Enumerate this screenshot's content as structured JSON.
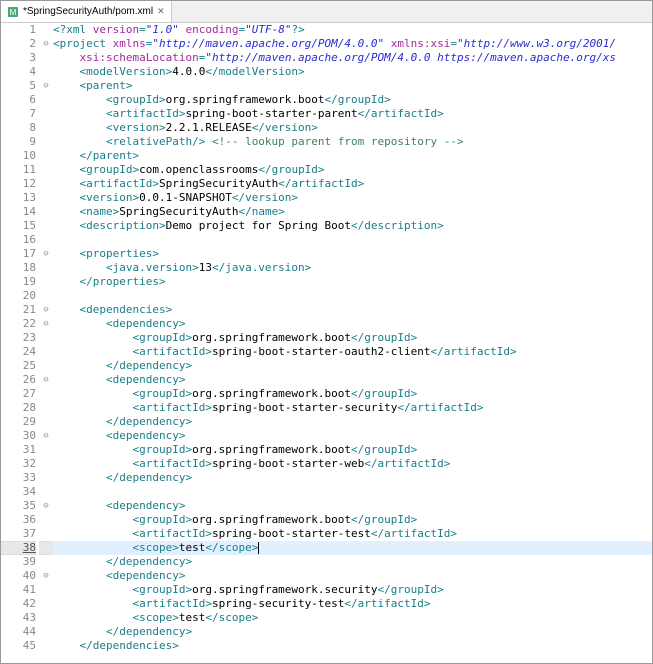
{
  "tab": {
    "icon": "M",
    "label": "*SpringSecurityAuth/pom.xml",
    "closeGlyph": "✕"
  },
  "currentLine": 38,
  "lines": [
    {
      "n": 1,
      "fold": "",
      "indent": 0,
      "tokens": [
        [
          "pi",
          "<?xml "
        ],
        [
          "attr",
          "version"
        ],
        [
          "pi",
          "="
        ],
        [
          "str",
          "\"1.0\""
        ],
        [
          "pi",
          " "
        ],
        [
          "attr",
          "encoding"
        ],
        [
          "pi",
          "="
        ],
        [
          "str",
          "\"UTF-8\""
        ],
        [
          "pi",
          "?>"
        ]
      ]
    },
    {
      "n": 2,
      "fold": "⊖",
      "indent": 0,
      "tokens": [
        [
          "tag",
          "<project "
        ],
        [
          "attr",
          "xmlns"
        ],
        [
          "tag",
          "="
        ],
        [
          "str",
          "\"http://maven.apache.org/POM/4.0.0\""
        ],
        [
          "tag",
          " "
        ],
        [
          "attr",
          "xmlns:xsi"
        ],
        [
          "tag",
          "="
        ],
        [
          "str",
          "\"http://www.w3.org/2001/"
        ]
      ]
    },
    {
      "n": 3,
      "fold": "",
      "indent": 1,
      "tokens": [
        [
          "attr",
          "xsi:schemaLocation"
        ],
        [
          "tag",
          "="
        ],
        [
          "str",
          "\"http://maven.apache.org/POM/4.0.0 https://maven.apache.org/xs"
        ]
      ]
    },
    {
      "n": 4,
      "fold": "",
      "indent": 1,
      "tokens": [
        [
          "tag",
          "<modelVersion>"
        ],
        [
          "txt",
          "4.0.0"
        ],
        [
          "tag",
          "</modelVersion>"
        ]
      ]
    },
    {
      "n": 5,
      "fold": "⊖",
      "indent": 1,
      "tokens": [
        [
          "tag",
          "<parent>"
        ]
      ]
    },
    {
      "n": 6,
      "fold": "",
      "indent": 2,
      "tokens": [
        [
          "tag",
          "<groupId>"
        ],
        [
          "txt",
          "org.springframework.boot"
        ],
        [
          "tag",
          "</groupId>"
        ]
      ]
    },
    {
      "n": 7,
      "fold": "",
      "indent": 2,
      "tokens": [
        [
          "tag",
          "<artifactId>"
        ],
        [
          "txt",
          "spring-boot-starter-parent"
        ],
        [
          "tag",
          "</artifactId>"
        ]
      ]
    },
    {
      "n": 8,
      "fold": "",
      "indent": 2,
      "tokens": [
        [
          "tag",
          "<version>"
        ],
        [
          "txt",
          "2.2.1.RELEASE"
        ],
        [
          "tag",
          "</version>"
        ]
      ]
    },
    {
      "n": 9,
      "fold": "",
      "indent": 2,
      "tokens": [
        [
          "tag",
          "<relativePath/> "
        ],
        [
          "com",
          "<!-- lookup parent from repository -->"
        ]
      ]
    },
    {
      "n": 10,
      "fold": "",
      "indent": 1,
      "tokens": [
        [
          "tag",
          "</parent>"
        ]
      ]
    },
    {
      "n": 11,
      "fold": "",
      "indent": 1,
      "tokens": [
        [
          "tag",
          "<groupId>"
        ],
        [
          "txt",
          "com.openclassrooms"
        ],
        [
          "tag",
          "</groupId>"
        ]
      ]
    },
    {
      "n": 12,
      "fold": "",
      "indent": 1,
      "tokens": [
        [
          "tag",
          "<artifactId>"
        ],
        [
          "txt",
          "SpringSecurityAuth"
        ],
        [
          "tag",
          "</artifactId>"
        ]
      ]
    },
    {
      "n": 13,
      "fold": "",
      "indent": 1,
      "tokens": [
        [
          "tag",
          "<version>"
        ],
        [
          "txt",
          "0.0.1-SNAPSHOT"
        ],
        [
          "tag",
          "</version>"
        ]
      ]
    },
    {
      "n": 14,
      "fold": "",
      "indent": 1,
      "tokens": [
        [
          "tag",
          "<name>"
        ],
        [
          "txt",
          "SpringSecurityAuth"
        ],
        [
          "tag",
          "</name>"
        ]
      ]
    },
    {
      "n": 15,
      "fold": "",
      "indent": 1,
      "tokens": [
        [
          "tag",
          "<description>"
        ],
        [
          "txt",
          "Demo project for Spring Boot"
        ],
        [
          "tag",
          "</description>"
        ]
      ]
    },
    {
      "n": 16,
      "fold": "",
      "indent": 0,
      "tokens": []
    },
    {
      "n": 17,
      "fold": "⊖",
      "indent": 1,
      "tokens": [
        [
          "tag",
          "<properties>"
        ]
      ]
    },
    {
      "n": 18,
      "fold": "",
      "indent": 2,
      "tokens": [
        [
          "tag",
          "<java.version>"
        ],
        [
          "txt",
          "13"
        ],
        [
          "tag",
          "</java.version>"
        ]
      ]
    },
    {
      "n": 19,
      "fold": "",
      "indent": 1,
      "tokens": [
        [
          "tag",
          "</properties>"
        ]
      ]
    },
    {
      "n": 20,
      "fold": "",
      "indent": 0,
      "tokens": []
    },
    {
      "n": 21,
      "fold": "⊖",
      "indent": 1,
      "tokens": [
        [
          "tag",
          "<dependencies>"
        ]
      ]
    },
    {
      "n": 22,
      "fold": "⊖",
      "indent": 2,
      "tokens": [
        [
          "tag",
          "<dependency>"
        ]
      ]
    },
    {
      "n": 23,
      "fold": "",
      "indent": 3,
      "tokens": [
        [
          "tag",
          "<groupId>"
        ],
        [
          "txt",
          "org.springframework.boot"
        ],
        [
          "tag",
          "</groupId>"
        ]
      ]
    },
    {
      "n": 24,
      "fold": "",
      "indent": 3,
      "tokens": [
        [
          "tag",
          "<artifactId>"
        ],
        [
          "txt",
          "spring-boot-starter-oauth2-client"
        ],
        [
          "tag",
          "</artifactId>"
        ]
      ]
    },
    {
      "n": 25,
      "fold": "",
      "indent": 2,
      "tokens": [
        [
          "tag",
          "</dependency>"
        ]
      ]
    },
    {
      "n": 26,
      "fold": "⊖",
      "indent": 2,
      "tokens": [
        [
          "tag",
          "<dependency>"
        ]
      ]
    },
    {
      "n": 27,
      "fold": "",
      "indent": 3,
      "tokens": [
        [
          "tag",
          "<groupId>"
        ],
        [
          "txt",
          "org.springframework.boot"
        ],
        [
          "tag",
          "</groupId>"
        ]
      ]
    },
    {
      "n": 28,
      "fold": "",
      "indent": 3,
      "tokens": [
        [
          "tag",
          "<artifactId>"
        ],
        [
          "txt",
          "spring-boot-starter-security"
        ],
        [
          "tag",
          "</artifactId>"
        ]
      ]
    },
    {
      "n": 29,
      "fold": "",
      "indent": 2,
      "tokens": [
        [
          "tag",
          "</dependency>"
        ]
      ]
    },
    {
      "n": 30,
      "fold": "⊖",
      "indent": 2,
      "tokens": [
        [
          "tag",
          "<dependency>"
        ]
      ]
    },
    {
      "n": 31,
      "fold": "",
      "indent": 3,
      "tokens": [
        [
          "tag",
          "<groupId>"
        ],
        [
          "txt",
          "org.springframework.boot"
        ],
        [
          "tag",
          "</groupId>"
        ]
      ]
    },
    {
      "n": 32,
      "fold": "",
      "indent": 3,
      "tokens": [
        [
          "tag",
          "<artifactId>"
        ],
        [
          "txt",
          "spring-boot-starter-web"
        ],
        [
          "tag",
          "</artifactId>"
        ]
      ]
    },
    {
      "n": 33,
      "fold": "",
      "indent": 2,
      "tokens": [
        [
          "tag",
          "</dependency>"
        ]
      ]
    },
    {
      "n": 34,
      "fold": "",
      "indent": 0,
      "tokens": []
    },
    {
      "n": 35,
      "fold": "⊖",
      "indent": 2,
      "tokens": [
        [
          "tag",
          "<dependency>"
        ]
      ]
    },
    {
      "n": 36,
      "fold": "",
      "indent": 3,
      "tokens": [
        [
          "tag",
          "<groupId>"
        ],
        [
          "txt",
          "org.springframework.boot"
        ],
        [
          "tag",
          "</groupId>"
        ]
      ]
    },
    {
      "n": 37,
      "fold": "",
      "indent": 3,
      "tokens": [
        [
          "tag",
          "<artifactId>"
        ],
        [
          "txt",
          "spring-boot-starter-test"
        ],
        [
          "tag",
          "</artifactId>"
        ]
      ]
    },
    {
      "n": 38,
      "fold": "",
      "indent": 3,
      "tokens": [
        [
          "tag",
          "<scope>"
        ],
        [
          "txt",
          "test"
        ],
        [
          "tag",
          "</scope>"
        ]
      ],
      "cursor": true
    },
    {
      "n": 39,
      "fold": "",
      "indent": 2,
      "tokens": [
        [
          "tag",
          "</dependency>"
        ]
      ]
    },
    {
      "n": 40,
      "fold": "⊖",
      "indent": 2,
      "tokens": [
        [
          "tag",
          "<dependency>"
        ]
      ]
    },
    {
      "n": 41,
      "fold": "",
      "indent": 3,
      "tokens": [
        [
          "tag",
          "<groupId>"
        ],
        [
          "txt",
          "org.springframework.security"
        ],
        [
          "tag",
          "</groupId>"
        ]
      ]
    },
    {
      "n": 42,
      "fold": "",
      "indent": 3,
      "tokens": [
        [
          "tag",
          "<artifactId>"
        ],
        [
          "txt",
          "spring-security-test"
        ],
        [
          "tag",
          "</artifactId>"
        ]
      ]
    },
    {
      "n": 43,
      "fold": "",
      "indent": 3,
      "tokens": [
        [
          "tag",
          "<scope>"
        ],
        [
          "txt",
          "test"
        ],
        [
          "tag",
          "</scope>"
        ]
      ]
    },
    {
      "n": 44,
      "fold": "",
      "indent": 2,
      "tokens": [
        [
          "tag",
          "</dependency>"
        ]
      ]
    },
    {
      "n": 45,
      "fold": "",
      "indent": 1,
      "tokens": [
        [
          "tag",
          "</dependencies>"
        ]
      ]
    }
  ]
}
